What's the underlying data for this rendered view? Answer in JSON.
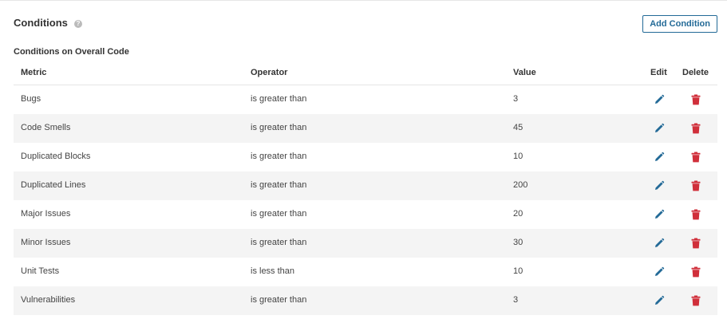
{
  "section": {
    "title": "Conditions",
    "help_icon": "question-circle-icon",
    "add_button_label": "Add Condition",
    "subtitle": "Conditions on Overall Code"
  },
  "table": {
    "headers": {
      "metric": "Metric",
      "operator": "Operator",
      "value": "Value",
      "edit": "Edit",
      "delete": "Delete"
    },
    "rows": [
      {
        "metric": "Bugs",
        "operator": "is greater than",
        "value": "3"
      },
      {
        "metric": "Code Smells",
        "operator": "is greater than",
        "value": "45"
      },
      {
        "metric": "Duplicated Blocks",
        "operator": "is greater than",
        "value": "10"
      },
      {
        "metric": "Duplicated Lines",
        "operator": "is greater than",
        "value": "200"
      },
      {
        "metric": "Major Issues",
        "operator": "is greater than",
        "value": "20"
      },
      {
        "metric": "Minor Issues",
        "operator": "is greater than",
        "value": "30"
      },
      {
        "metric": "Unit Tests",
        "operator": "is less than",
        "value": "10"
      },
      {
        "metric": "Vulnerabilities",
        "operator": "is greater than",
        "value": "3"
      }
    ]
  },
  "colors": {
    "accent": "#236a97",
    "delete": "#d02f3a",
    "row_alt": "#f4f4f4"
  }
}
